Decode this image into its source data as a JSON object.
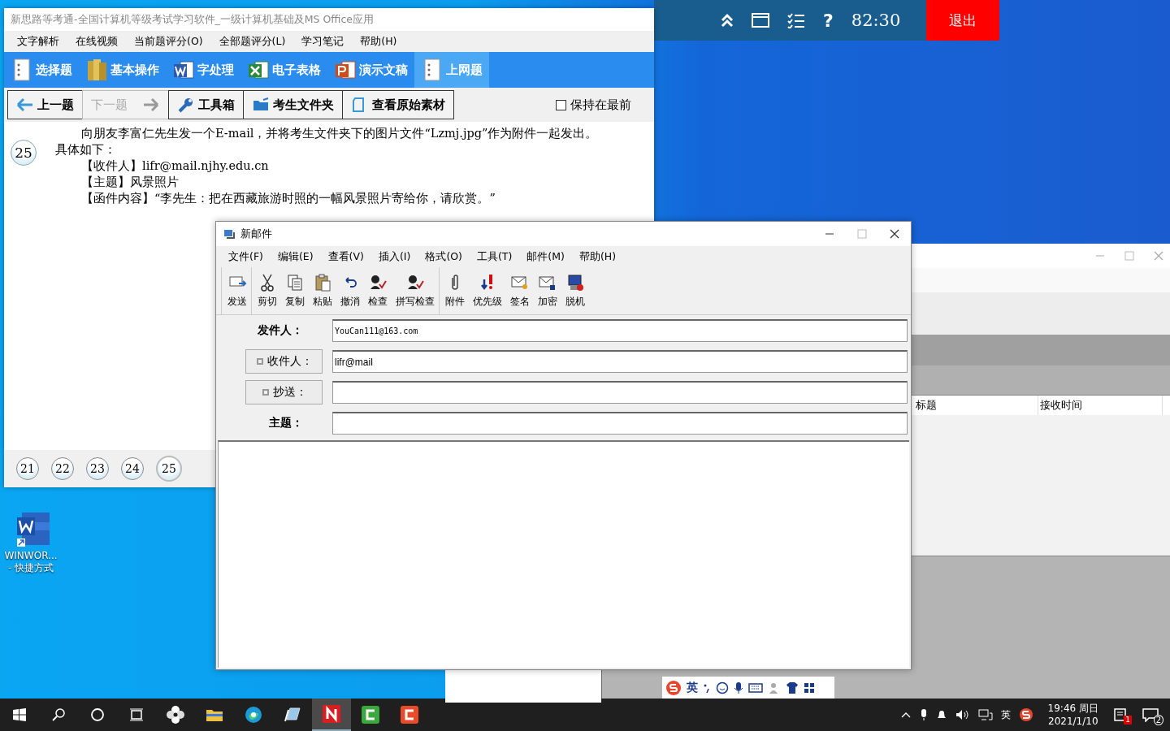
{
  "exam_bar": {
    "help": "?",
    "timer": "82:30",
    "exit_button": "退出"
  },
  "exam_window": {
    "title": "新思路等考通-全国计算机等级考试学习软件_一级计算机基础及MS Office应用",
    "menu": [
      "文字解析",
      "在线视频",
      "当前题评分(O)",
      "全部题评分(L)",
      "学习笔记",
      "帮助(H)"
    ],
    "tabs": [
      {
        "label": "选择题",
        "selected": false
      },
      {
        "label": "基本操作",
        "selected": false
      },
      {
        "label": "字处理",
        "selected": false
      },
      {
        "label": "电子表格",
        "selected": false
      },
      {
        "label": "演示文稿",
        "selected": false
      },
      {
        "label": "上网题",
        "selected": true
      }
    ],
    "toolbar": [
      {
        "label": "上一题",
        "disabled": false
      },
      {
        "label": "下一题",
        "disabled": true
      },
      {
        "label": "工具箱",
        "disabled": false
      },
      {
        "label": "考生文件夹",
        "disabled": false
      },
      {
        "label": "查看原始素材",
        "disabled": false
      }
    ],
    "keep_on_top": {
      "label": "保持在最前",
      "checked": false
    },
    "question": {
      "number": "25",
      "intro": "向朋友李富仁先生发一个E-mail，并将考生文件夹下的图片文件“Lzmj.jpg”作为附件一起发出。",
      "lead": "具体如下：",
      "lines": [
        "【收件人】lifr@mail.njhy.edu.cn",
        "【主题】风景照片",
        "【函件内容】“李先生：把在西藏旅游时照的一幅风景照片寄给你，请欣赏。”"
      ]
    },
    "question_nav": [
      {
        "label": "21",
        "selected": false
      },
      {
        "label": "22",
        "selected": false
      },
      {
        "label": "23",
        "selected": false
      },
      {
        "label": "24",
        "selected": false
      },
      {
        "label": "25",
        "selected": true
      }
    ]
  },
  "desktop_icon": {
    "name": "WINWOR...",
    "suffix": "- 快捷方式"
  },
  "background_window": {
    "columns": [
      "标题",
      "接收时间"
    ]
  },
  "mail_window": {
    "title": "新邮件",
    "menu": [
      "文件(F)",
      "编辑(E)",
      "查看(V)",
      "插入(I)",
      "格式(O)",
      "工具(T)",
      "邮件(M)",
      "帮助(H)"
    ],
    "toolbar_groups": [
      [
        "发送"
      ],
      [
        "剪切",
        "复制",
        "粘贴",
        "撤消",
        "检查",
        "拼写检查"
      ],
      [
        "附件",
        "优先级",
        "签名",
        "加密",
        "脱机"
      ]
    ],
    "fields": [
      {
        "label": "发件人：",
        "kind": "plain",
        "value": "YouCan111@163.com"
      },
      {
        "label": "收件人：",
        "kind": "button",
        "value": "lifr@mail"
      },
      {
        "label": "抄送：",
        "kind": "button"
      },
      {
        "label": "主题：",
        "kind": "plain"
      }
    ]
  },
  "ime_bar": {
    "mode": "英"
  },
  "taskbar": {
    "apps": [
      {
        "active": false
      },
      {
        "active": false
      },
      {
        "active": false
      },
      {
        "active": true
      },
      {
        "active": false
      },
      {
        "active": false
      }
    ],
    "input_mode": "英",
    "time": "19:46 周日",
    "date": "2021/1/10",
    "notification_badge": "1",
    "action_center_count": "2"
  }
}
